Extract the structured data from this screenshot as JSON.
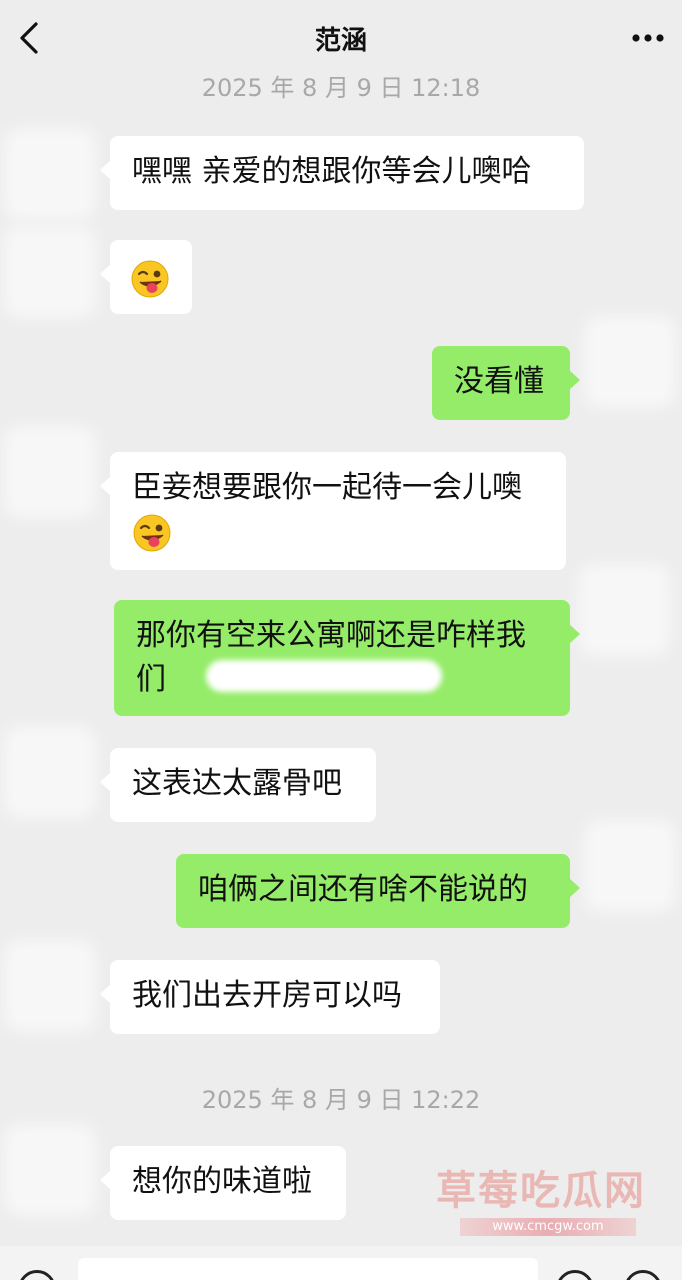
{
  "header": {
    "title": "范涵",
    "back_icon": "chevron-left-icon",
    "more_icon": "more-dots-icon"
  },
  "timestamps": {
    "first": "2025 年 8 月 9 日 12:18",
    "second": "2025 年 8 月 9 日 12:22"
  },
  "messages": [
    {
      "side": "in",
      "text": "嘿嘿  亲爱的想跟你等会儿噢哈"
    },
    {
      "side": "in",
      "text": "",
      "emoji": "winking-tongue-emoji"
    },
    {
      "side": "out",
      "text": "没看懂"
    },
    {
      "side": "in",
      "text": "臣妾想要跟你一起待一会儿噢",
      "emoji": "winking-tongue-emoji"
    },
    {
      "side": "out",
      "text_line1": "那你有空来公寓啊还是咋样我",
      "text_line2": "们"
    },
    {
      "side": "in",
      "text": "这表达太露骨吧"
    },
    {
      "side": "out",
      "text": "咱俩之间还有啥不能说的"
    },
    {
      "side": "in",
      "text": "我们出去开房可以吗"
    },
    {
      "side": "in",
      "text": "想你的味道啦"
    }
  ],
  "watermark": {
    "text": "草莓吃瓜网",
    "url": "www.cmcgw.com"
  },
  "colors": {
    "background": "#ededed",
    "incoming_bubble": "#ffffff",
    "outgoing_bubble": "#95ec69",
    "timestamp": "#a8a8a8"
  }
}
